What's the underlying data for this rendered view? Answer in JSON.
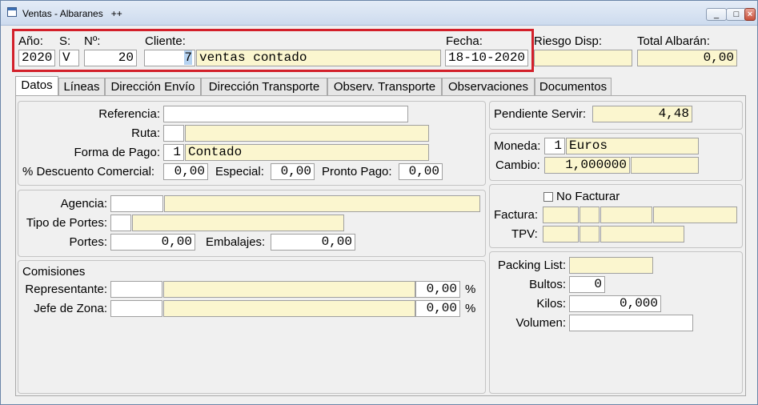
{
  "window": {
    "title": "Ventas - Albaranes",
    "title_suffix": "++"
  },
  "header": {
    "anio_label": "Año:",
    "anio_value": "2020",
    "serie_label": "S:",
    "serie_value": "V",
    "numero_label": "Nº:",
    "numero_value": "20",
    "cliente_label": "Cliente:",
    "cliente_code": "7",
    "cliente_name": "ventas contado",
    "fecha_label": "Fecha:",
    "fecha_value": "18-10-2020",
    "riesgo_label": "Riesgo Disp:",
    "riesgo_value": "",
    "total_label": "Total Albarán:",
    "total_value": "0,00"
  },
  "tabs": [
    "Datos",
    "Líneas",
    "Dirección Envío",
    "Dirección Transporte",
    "Observ. Transporte",
    "Observaciones",
    "Documentos"
  ],
  "datos": {
    "referencia_label": "Referencia:",
    "referencia_value": "",
    "ruta_label": "Ruta:",
    "ruta_code": "",
    "ruta_name": "",
    "forma_pago_label": "Forma de Pago:",
    "forma_pago_code": "1",
    "forma_pago_name": "Contado",
    "descuento_label": "% Descuento Comercial:",
    "descuento_value": "0,00",
    "especial_label": "Especial:",
    "especial_value": "0,00",
    "pronto_pago_label": "Pronto Pago:",
    "pronto_pago_value": "0,00",
    "agencia_label": "Agencia:",
    "agencia_code": "",
    "agencia_name": "",
    "tipo_portes_label": "Tipo de Portes:",
    "tipo_portes_code": "",
    "tipo_portes_name": "",
    "portes_label": "Portes:",
    "portes_value": "0,00",
    "embalajes_label": "Embalajes:",
    "embalajes_value": "0,00",
    "comisiones_title": "Comisiones",
    "representante_label": "Representante:",
    "representante_code": "",
    "representante_name": "",
    "representante_pct": "0,00",
    "jefe_zona_label": "Jefe de Zona:",
    "jefe_zona_code": "",
    "jefe_zona_name": "",
    "jefe_zona_pct": "0,00",
    "pct_symbol": "%"
  },
  "right": {
    "pendiente_label": "Pendiente Servir:",
    "pendiente_value": "4,48",
    "moneda_label": "Moneda:",
    "moneda_code": "1",
    "moneda_name": "Euros",
    "cambio_label": "Cambio:",
    "cambio_value": "1,000000",
    "no_facturar_label": "No Facturar",
    "factura_label": "Factura:",
    "tpv_label": "TPV:",
    "packing_label": "Packing List:",
    "packing_value": "",
    "bultos_label": "Bultos:",
    "bultos_value": "0",
    "kilos_label": "Kilos:",
    "kilos_value": "0,000",
    "volumen_label": "Volumen:",
    "volumen_value": ""
  },
  "colors": {
    "highlight_border": "#d3202a",
    "readonly_field": "#fbf6cf",
    "editable_field": "#ffffff"
  }
}
